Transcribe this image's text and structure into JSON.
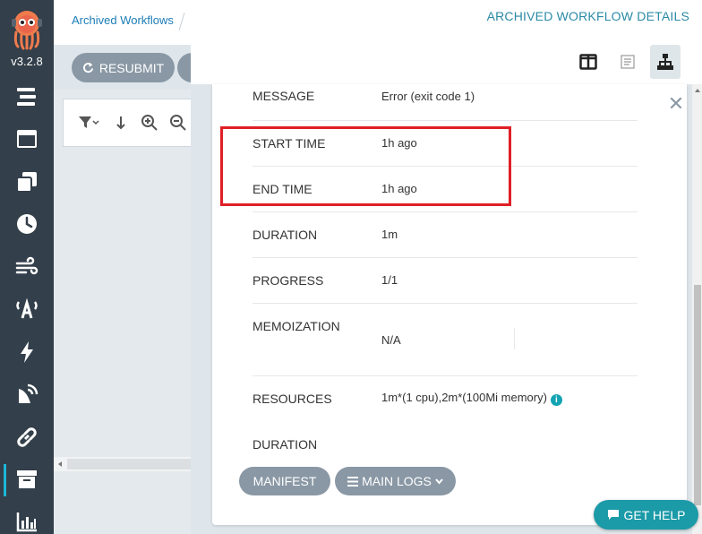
{
  "app": {
    "version": "v3.2.8"
  },
  "header": {
    "breadcrumb": "Archived Workflows",
    "page_title": "ARCHIVED WORKFLOW DETAILS"
  },
  "toolbar": {
    "resubmit_label": "RESUBMIT"
  },
  "sidebar": {
    "items": [
      {
        "icon": "stream-icon"
      },
      {
        "icon": "window-icon"
      },
      {
        "icon": "clone-icon"
      },
      {
        "icon": "clock-icon"
      },
      {
        "icon": "wind-icon"
      },
      {
        "icon": "broadcast-icon"
      },
      {
        "icon": "bolt-icon"
      },
      {
        "icon": "satellite-dish-icon"
      },
      {
        "icon": "link-icon"
      },
      {
        "icon": "archive-icon",
        "active": true
      },
      {
        "icon": "chart-bar-icon"
      }
    ]
  },
  "details": {
    "rows": [
      {
        "key": "MESSAGE",
        "value": "Error (exit code 1)"
      },
      {
        "key": "START TIME",
        "value": "1h ago"
      },
      {
        "key": "END TIME",
        "value": "1h ago"
      },
      {
        "key": "DURATION",
        "value": "1m"
      },
      {
        "key": "PROGRESS",
        "value": "1/1"
      },
      {
        "key": "MEMOIZATION",
        "value": "N/A"
      },
      {
        "key": "RESOURCES",
        "value": "1m*(1 cpu),2m*(100Mi memory)"
      },
      {
        "key": "DURATION",
        "value": ""
      }
    ]
  },
  "actions": {
    "manifest_label": "MANIFEST",
    "logs_label": "MAIN LOGS"
  },
  "help": {
    "label": "GET HELP"
  },
  "colors": {
    "sidebar": "#333f4a",
    "button": "#8a98a5",
    "accent": "#1b9aa8",
    "highlight": "#e01f26"
  }
}
